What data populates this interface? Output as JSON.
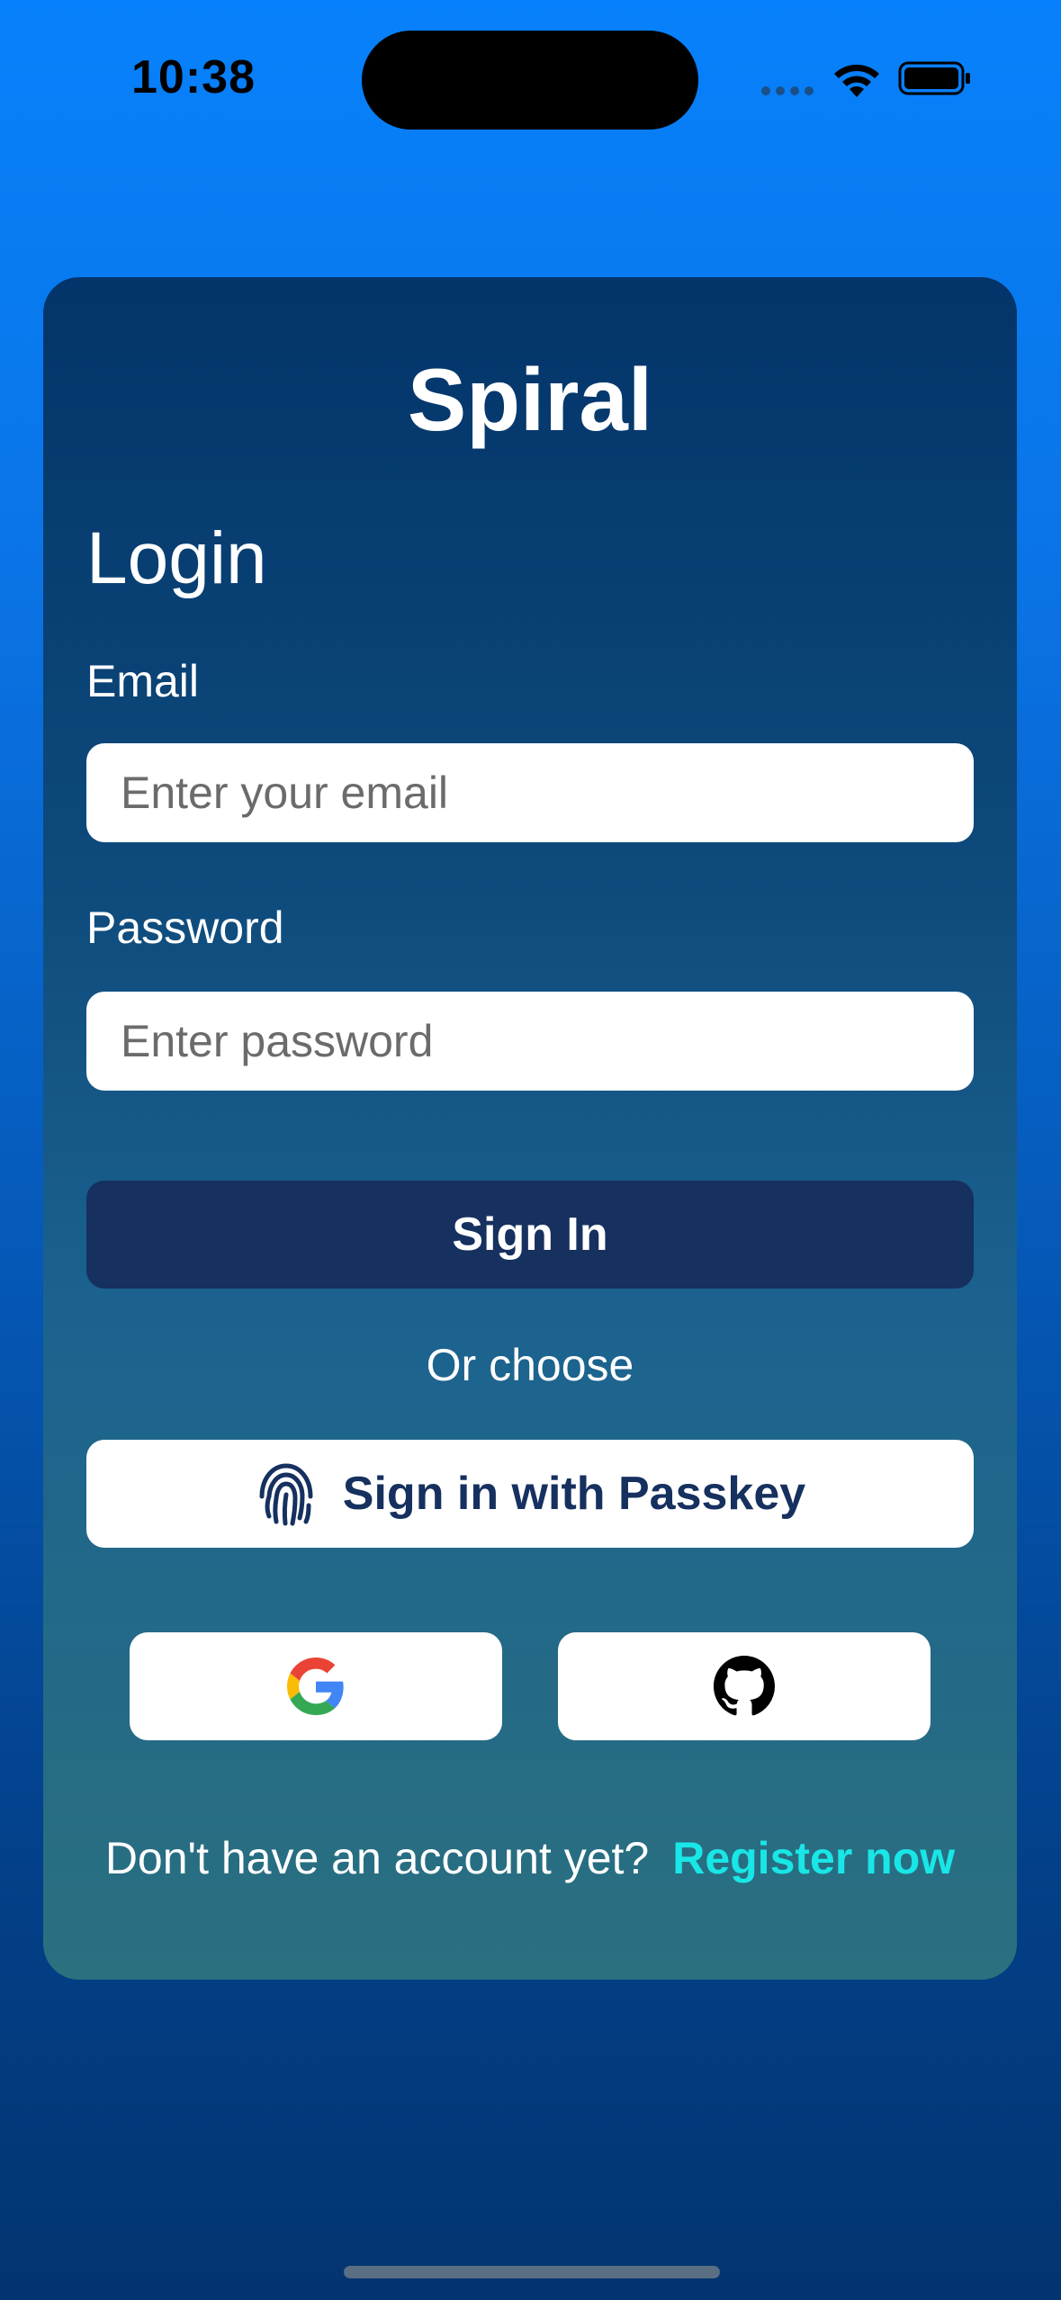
{
  "status_bar": {
    "time": "10:38",
    "icons": [
      "cellular-dots-icon",
      "wifi-icon",
      "battery-icon"
    ]
  },
  "card": {
    "app_title": "Spiral",
    "heading": "Login",
    "email": {
      "label": "Email",
      "value": "",
      "placeholder": "Enter your email"
    },
    "password": {
      "label": "Password",
      "value": "",
      "placeholder": "Enter password"
    },
    "sign_in_label": "Sign In",
    "divider_text": "Or choose",
    "passkey": {
      "label": "Sign in with Passkey",
      "icon": "fingerprint-icon"
    },
    "social": [
      {
        "provider_icon": "google-icon"
      },
      {
        "provider_icon": "github-icon"
      }
    ],
    "footer": {
      "prompt": "Don't have an account yet?",
      "link": "Register now"
    }
  },
  "colors": {
    "background_top": "#0781fb",
    "background_bottom": "#03346f",
    "card_top": "#03346a",
    "card_bottom": "#2b707f",
    "primary_button": "#16305f",
    "link": "#19e6e6"
  }
}
